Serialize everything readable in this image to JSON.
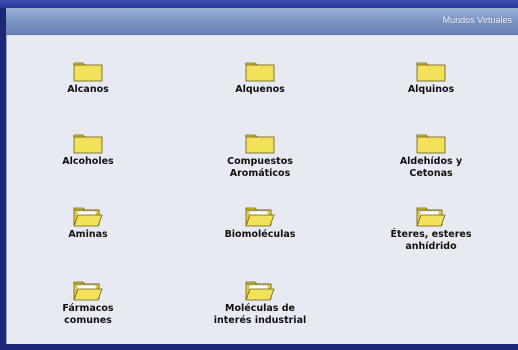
{
  "window": {
    "title": "Mundos Virtuales"
  },
  "folders": [
    {
      "label": "Alcanos",
      "icon": "folder-icon",
      "state": "closed"
    },
    {
      "label": "Alquenos",
      "icon": "folder-icon",
      "state": "closed"
    },
    {
      "label": "Alquinos",
      "icon": "folder-icon",
      "state": "closed"
    },
    {
      "label": "Alcoholes",
      "icon": "folder-icon",
      "state": "closed"
    },
    {
      "label": "Compuestos\nAromáticos",
      "icon": "folder-icon",
      "state": "closed"
    },
    {
      "label": "Aldehídos y\nCetonas",
      "icon": "folder-icon",
      "state": "closed"
    },
    {
      "label": "Aminas",
      "icon": "open-folder-icon",
      "state": "open"
    },
    {
      "label": "Biomoléculas",
      "icon": "open-folder-icon",
      "state": "open"
    },
    {
      "label": "Éteres, esteres\nanhídrido",
      "icon": "open-folder-icon",
      "state": "open"
    },
    {
      "label": "Fármacos\ncomunes",
      "icon": "open-folder-icon",
      "state": "open"
    },
    {
      "label": "Moléculas de\ninterés industrial",
      "icon": "open-folder-icon",
      "state": "open"
    }
  ],
  "colors": {
    "background": "#1c2778",
    "window": "#e7ebf1",
    "folder": "#f2e25a",
    "titlebar": "#7c94c4"
  }
}
